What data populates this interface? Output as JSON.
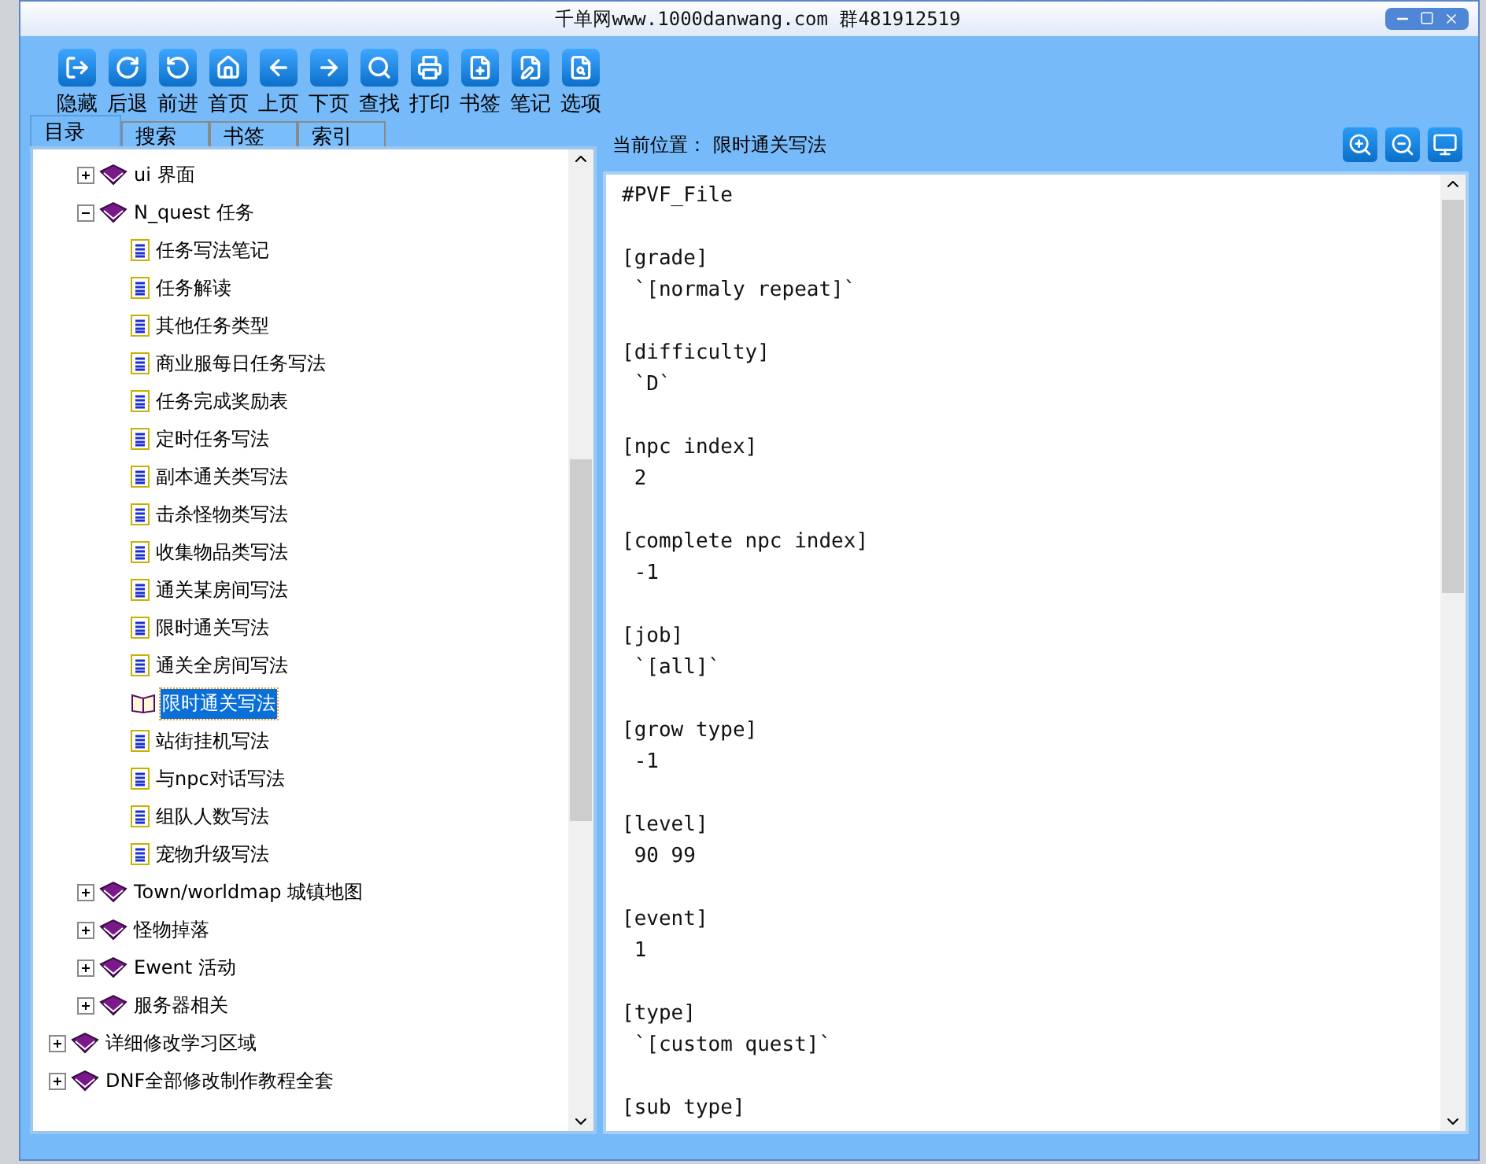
{
  "window": {
    "title": "千单网www.1000danwang.com 群481912519"
  },
  "toolbar": [
    {
      "label": "隐藏",
      "kind": "hide"
    },
    {
      "label": "后退",
      "kind": "back"
    },
    {
      "label": "前进",
      "kind": "forward"
    },
    {
      "label": "首页",
      "kind": "home"
    },
    {
      "label": "上页",
      "kind": "prev"
    },
    {
      "label": "下页",
      "kind": "next"
    },
    {
      "label": "查找",
      "kind": "find"
    },
    {
      "label": "打印",
      "kind": "print"
    },
    {
      "label": "书签",
      "kind": "bookmark"
    },
    {
      "label": "笔记",
      "kind": "note"
    },
    {
      "label": "选项",
      "kind": "options"
    }
  ],
  "tabs": [
    {
      "label": "目录",
      "selected": true
    },
    {
      "label": "搜索",
      "selected": false
    },
    {
      "label": "书签",
      "selected": false
    },
    {
      "label": "索引",
      "selected": false
    }
  ],
  "tree": {
    "items": [
      {
        "kind": "book",
        "children": [
          {
            "kind": "book",
            "label": "ui  界面",
            "expanded": false
          },
          {
            "kind": "book",
            "label": "N_quest  任务",
            "expanded": true,
            "children": [
              {
                "kind": "page",
                "label": "任务写法笔记",
                "selected": false
              },
              {
                "kind": "page",
                "label": "任务解读",
                "selected": false
              },
              {
                "kind": "page",
                "label": "其他任务类型",
                "selected": false
              },
              {
                "kind": "page",
                "label": "商业服每日任务写法",
                "selected": false
              },
              {
                "kind": "page",
                "label": "任务完成奖励表",
                "selected": false
              },
              {
                "kind": "page",
                "label": "定时任务写法",
                "selected": false
              },
              {
                "kind": "page",
                "label": "副本通关类写法",
                "selected": false
              },
              {
                "kind": "page",
                "label": "击杀怪物类写法",
                "selected": false
              },
              {
                "kind": "page",
                "label": "收集物品类写法",
                "selected": false
              },
              {
                "kind": "page",
                "label": "通关某房间写法",
                "selected": false
              },
              {
                "kind": "page",
                "label": "限时通关写法",
                "selected": false
              },
              {
                "kind": "page",
                "label": "通关全房间写法",
                "selected": false
              },
              {
                "kind": "page",
                "label": "限时通关写法",
                "selected": true
              },
              {
                "kind": "page",
                "label": "站街挂机写法",
                "selected": false
              },
              {
                "kind": "page",
                "label": "与npc对话写法",
                "selected": false
              },
              {
                "kind": "page",
                "label": "组队人数写法",
                "selected": false
              },
              {
                "kind": "page",
                "label": "宠物升级写法",
                "selected": false
              }
            ]
          },
          {
            "kind": "book",
            "label": "Town/worldmap  城镇地图",
            "expanded": false
          },
          {
            "kind": "book",
            "label": "怪物掉落",
            "expanded": false
          },
          {
            "kind": "book",
            "label": "Ewent 活动",
            "expanded": false
          },
          {
            "kind": "book",
            "label": "服务器相关",
            "expanded": false
          }
        ]
      },
      {
        "kind": "book",
        "label": "详细修改学习区域",
        "expanded": false
      },
      {
        "kind": "book",
        "label": "DNF全部修改制作教程全套",
        "expanded": false
      }
    ]
  },
  "location": {
    "label": "当前位置：",
    "value": "限时通关写法"
  },
  "content": {
    "header": "#PVF_File",
    "sections": [
      {
        "key": "[grade]",
        "value": " `[normaly repeat]`"
      },
      {
        "key": "[difficulty]",
        "value": " `D`"
      },
      {
        "key": "[npc index]",
        "value": " 2"
      },
      {
        "key": "[complete npc index]",
        "value": " -1"
      },
      {
        "key": "[job]",
        "value": " `[all]`"
      },
      {
        "key": "[grow type]",
        "value": " -1"
      },
      {
        "key": "[level]",
        "value": " 90 99"
      },
      {
        "key": "[event]",
        "value": " 1"
      },
      {
        "key": "[type]",
        "value": " `[custom quest]`"
      },
      {
        "key": "[sub type]"
      }
    ]
  }
}
